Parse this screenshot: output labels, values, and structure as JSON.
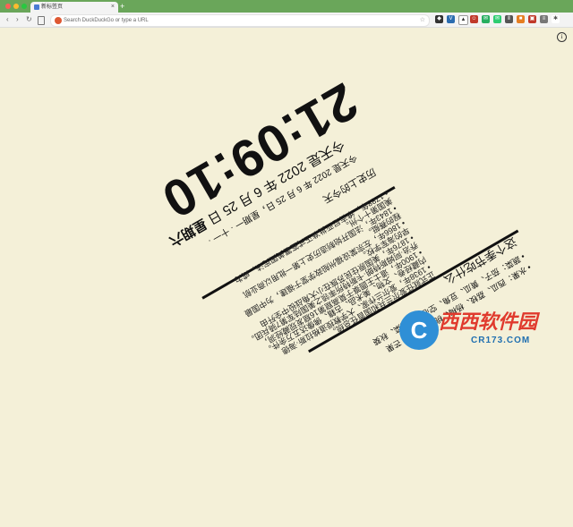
{
  "browser": {
    "tab_title": "新标签页",
    "tab_close": "×",
    "new_tab": "+",
    "nav_back": "‹",
    "nav_forward": "›",
    "nav_reload": "↻",
    "omnibox_placeholder": "Search DuckDuckGo or type a URL",
    "extensions": [
      "shield-icon",
      "v-icon",
      "triangle-icon",
      "face-icon",
      "chat-icon",
      "chat-icon",
      "pause-icon",
      "cube-icon",
      "square-icon",
      "menu-icon",
      "puzzle-icon"
    ]
  },
  "info_button": "i",
  "clock": {
    "time": "21:09:10",
    "date": "2022 年 6 月 25 日",
    "weekday": "星期六",
    "date_prefix": "今天是",
    "sub_line": "今天是 2022 年 6 月 25 日，星期一 · 十一 ·"
  },
  "history": {
    "title": "历史上的今天",
    "events": [
      "• 1788年，维吉尼亚批准正式签署美国宪法，成为",
      "美国第十个州。",
      "• 1843年，法国开始制造历史上第一批用以商业航",
      "程的赛艇。",
      "• 1866年，左宗棠设福州船政学堂于福建，为中国最",
      "早的海军学校。",
      "• 1876年，美国原住民苏族在小大角战役中全歼由",
      "乔治·阿姆斯特朗·卡斯特所率领之美国陆军第7骑兵团。",
      "• 1900年，道士王圆箓于莫高窟第16窟发现藏经洞，",
      "内藏经卷、文物、美术品、古籍、佛像达五万余件。",
      "• 1938年，爱尔兰作家、大学教授道格拉斯·海德",
      "正式就任爱尔兰共和国首任总统。"
    ]
  },
  "calendar": {
    "title": "这个季节吃什么",
    "line1": "• 蔬菜：茄子、黄瓜、豆角、空心菜、苋菜、秋葵",
    "line2": "• 水果：西瓜、荔枝、杨梅、桃子、李子、芒果"
  },
  "watermark": {
    "logo_letter": "C",
    "name": "西西软件园",
    "site": "CR173.COM"
  },
  "colors": {
    "background": "#f4f0d8",
    "tabbar": "#6aa65a",
    "accent_red": "#dd0000"
  }
}
